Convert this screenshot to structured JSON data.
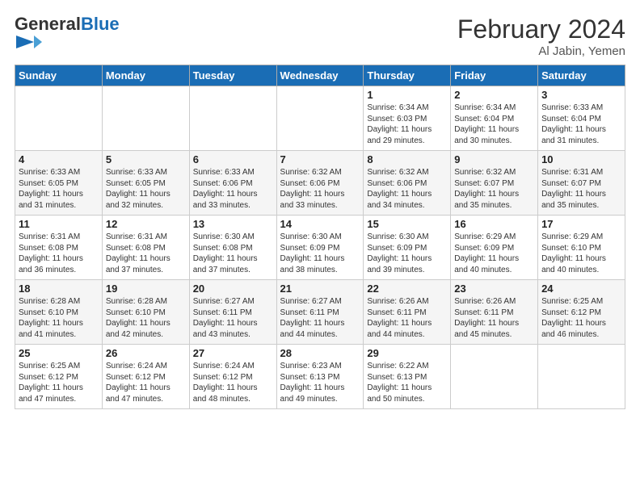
{
  "header": {
    "logo_general": "General",
    "logo_blue": "Blue",
    "title": "February 2024",
    "subtitle": "Al Jabin, Yemen"
  },
  "weekdays": [
    "Sunday",
    "Monday",
    "Tuesday",
    "Wednesday",
    "Thursday",
    "Friday",
    "Saturday"
  ],
  "weeks": [
    [
      {
        "day": "",
        "info": ""
      },
      {
        "day": "",
        "info": ""
      },
      {
        "day": "",
        "info": ""
      },
      {
        "day": "",
        "info": ""
      },
      {
        "day": "1",
        "info": "Sunrise: 6:34 AM\nSunset: 6:03 PM\nDaylight: 11 hours and 29 minutes."
      },
      {
        "day": "2",
        "info": "Sunrise: 6:34 AM\nSunset: 6:04 PM\nDaylight: 11 hours and 30 minutes."
      },
      {
        "day": "3",
        "info": "Sunrise: 6:33 AM\nSunset: 6:04 PM\nDaylight: 11 hours and 31 minutes."
      }
    ],
    [
      {
        "day": "4",
        "info": "Sunrise: 6:33 AM\nSunset: 6:05 PM\nDaylight: 11 hours and 31 minutes."
      },
      {
        "day": "5",
        "info": "Sunrise: 6:33 AM\nSunset: 6:05 PM\nDaylight: 11 hours and 32 minutes."
      },
      {
        "day": "6",
        "info": "Sunrise: 6:33 AM\nSunset: 6:06 PM\nDaylight: 11 hours and 33 minutes."
      },
      {
        "day": "7",
        "info": "Sunrise: 6:32 AM\nSunset: 6:06 PM\nDaylight: 11 hours and 33 minutes."
      },
      {
        "day": "8",
        "info": "Sunrise: 6:32 AM\nSunset: 6:06 PM\nDaylight: 11 hours and 34 minutes."
      },
      {
        "day": "9",
        "info": "Sunrise: 6:32 AM\nSunset: 6:07 PM\nDaylight: 11 hours and 35 minutes."
      },
      {
        "day": "10",
        "info": "Sunrise: 6:31 AM\nSunset: 6:07 PM\nDaylight: 11 hours and 35 minutes."
      }
    ],
    [
      {
        "day": "11",
        "info": "Sunrise: 6:31 AM\nSunset: 6:08 PM\nDaylight: 11 hours and 36 minutes."
      },
      {
        "day": "12",
        "info": "Sunrise: 6:31 AM\nSunset: 6:08 PM\nDaylight: 11 hours and 37 minutes."
      },
      {
        "day": "13",
        "info": "Sunrise: 6:30 AM\nSunset: 6:08 PM\nDaylight: 11 hours and 37 minutes."
      },
      {
        "day": "14",
        "info": "Sunrise: 6:30 AM\nSunset: 6:09 PM\nDaylight: 11 hours and 38 minutes."
      },
      {
        "day": "15",
        "info": "Sunrise: 6:30 AM\nSunset: 6:09 PM\nDaylight: 11 hours and 39 minutes."
      },
      {
        "day": "16",
        "info": "Sunrise: 6:29 AM\nSunset: 6:09 PM\nDaylight: 11 hours and 40 minutes."
      },
      {
        "day": "17",
        "info": "Sunrise: 6:29 AM\nSunset: 6:10 PM\nDaylight: 11 hours and 40 minutes."
      }
    ],
    [
      {
        "day": "18",
        "info": "Sunrise: 6:28 AM\nSunset: 6:10 PM\nDaylight: 11 hours and 41 minutes."
      },
      {
        "day": "19",
        "info": "Sunrise: 6:28 AM\nSunset: 6:10 PM\nDaylight: 11 hours and 42 minutes."
      },
      {
        "day": "20",
        "info": "Sunrise: 6:27 AM\nSunset: 6:11 PM\nDaylight: 11 hours and 43 minutes."
      },
      {
        "day": "21",
        "info": "Sunrise: 6:27 AM\nSunset: 6:11 PM\nDaylight: 11 hours and 44 minutes."
      },
      {
        "day": "22",
        "info": "Sunrise: 6:26 AM\nSunset: 6:11 PM\nDaylight: 11 hours and 44 minutes."
      },
      {
        "day": "23",
        "info": "Sunrise: 6:26 AM\nSunset: 6:11 PM\nDaylight: 11 hours and 45 minutes."
      },
      {
        "day": "24",
        "info": "Sunrise: 6:25 AM\nSunset: 6:12 PM\nDaylight: 11 hours and 46 minutes."
      }
    ],
    [
      {
        "day": "25",
        "info": "Sunrise: 6:25 AM\nSunset: 6:12 PM\nDaylight: 11 hours and 47 minutes."
      },
      {
        "day": "26",
        "info": "Sunrise: 6:24 AM\nSunset: 6:12 PM\nDaylight: 11 hours and 47 minutes."
      },
      {
        "day": "27",
        "info": "Sunrise: 6:24 AM\nSunset: 6:12 PM\nDaylight: 11 hours and 48 minutes."
      },
      {
        "day": "28",
        "info": "Sunrise: 6:23 AM\nSunset: 6:13 PM\nDaylight: 11 hours and 49 minutes."
      },
      {
        "day": "29",
        "info": "Sunrise: 6:22 AM\nSunset: 6:13 PM\nDaylight: 11 hours and 50 minutes."
      },
      {
        "day": "",
        "info": ""
      },
      {
        "day": "",
        "info": ""
      }
    ]
  ]
}
